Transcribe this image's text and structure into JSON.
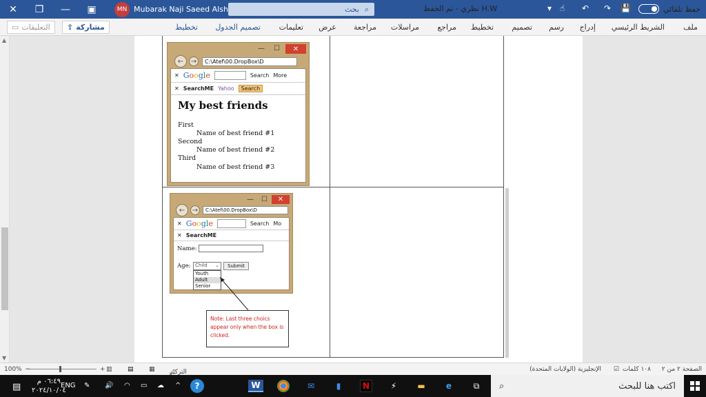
{
  "title_bar": {
    "user_initials": "MN",
    "user_name": "Mubarak Naji Saeed Alshahrani",
    "search_label": "بحث",
    "document_title": "H.W نظري - تم الحفظ",
    "autosave_label": "حفظ تلقائي"
  },
  "ribbon": {
    "tabs": [
      "ملف",
      "الشريط الرئيسي",
      "إدراج",
      "رسم",
      "تصميم",
      "تخطيط",
      "مراجع",
      "مراسلات",
      "مراجعة",
      "عرض",
      "تعليمات"
    ],
    "context_tabs": [
      "تصميم الجدول",
      "تخطيط"
    ],
    "share_label": "مشاركة",
    "comments_label": "التعليقات"
  },
  "browser1": {
    "address": "C:\\Atef\\00.DropBox\\D",
    "google_label": "Google",
    "search_label": "Search",
    "more_label": "More",
    "searchme_label": "SearchME",
    "yahoo_label": "Yahoo",
    "search_button": "Search",
    "page_title": "My best friends",
    "items": [
      {
        "term": "First",
        "desc": "Name of best friend #1"
      },
      {
        "term": "Second",
        "desc": "Name of best friend #2"
      },
      {
        "term": "Third",
        "desc": "Name of best friend #3"
      }
    ]
  },
  "browser2": {
    "address": "C:\\Atef\\00.DropBox\\D",
    "google_label": "Google",
    "search_label": "Search",
    "more_label": "Mo",
    "searchme_label": "SearchME",
    "name_label": "Name:",
    "age_label": "Age:",
    "age_selected": "Child",
    "submit_label": "Submit",
    "options": [
      "Youth",
      "Adult",
      "Senior"
    ]
  },
  "note": {
    "text": "Note: Last three choics appear only when the box is clicked."
  },
  "status_bar": {
    "page_info": "الصفحة ٢ من ٢",
    "word_count": "١٠٨ كلمات",
    "language": "الإنجليزية (الولايات المتحدة)",
    "focus_label": "التركيز",
    "zoom": "100%"
  },
  "taskbar": {
    "search_placeholder": "اكتب هنا للبحث",
    "language": "ENG",
    "time": "٠٦:٤٩ م",
    "date": "٢٠٢٤/١٠/٠٤",
    "apps": [
      "task-view",
      "edge",
      "file-explorer",
      "store",
      "mail",
      "chrome",
      "word"
    ]
  }
}
